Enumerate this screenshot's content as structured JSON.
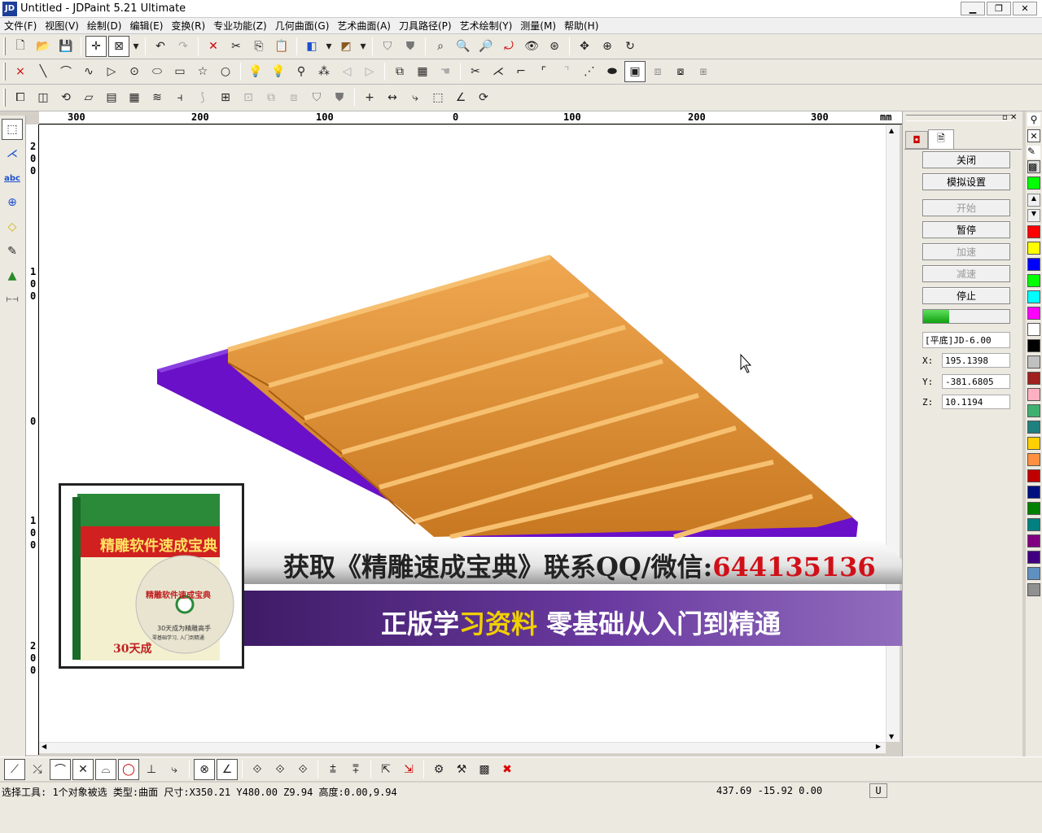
{
  "window": {
    "title": "Untitled - JDPaint 5.21 Ultimate",
    "logo": "JD"
  },
  "menu": [
    "文件(F)",
    "视图(V)",
    "绘制(D)",
    "编辑(E)",
    "变换(R)",
    "专业功能(Z)",
    "几何曲面(G)",
    "艺术曲面(A)",
    "刀具路径(P)",
    "艺术绘制(Y)",
    "测量(M)",
    "帮助(H)"
  ],
  "ruler": {
    "unit": "mm",
    "h_labels": [
      "300",
      "200",
      "100",
      "0",
      "100",
      "200",
      "300"
    ],
    "v_labels": [
      "200",
      "100",
      "0",
      "100",
      "200"
    ]
  },
  "right_panel": {
    "buttons": [
      {
        "label": "关闭",
        "enabled": true
      },
      {
        "label": "模拟设置",
        "enabled": true
      },
      {
        "label": "开始",
        "enabled": false
      },
      {
        "label": "暂停",
        "enabled": true
      },
      {
        "label": "加速",
        "enabled": false
      },
      {
        "label": "减速",
        "enabled": false
      },
      {
        "label": "停止",
        "enabled": true
      }
    ],
    "progress": 0.3,
    "tool": "[平底]JD-6.00",
    "x_label": "X:",
    "x": "195.1398",
    "y_label": "Y:",
    "y": "-381.6805",
    "z_label": "Z:",
    "z": "10.1194"
  },
  "palette": [
    "#00ff00",
    "#ff0000",
    "#ffff00",
    "#0000ff",
    "#00ff00",
    "#00ffff",
    "#ff00ff",
    "#ffffff",
    "#000000",
    "#c0c0c0",
    "#a02020",
    "#ffb0c0",
    "#40b070",
    "#208080",
    "#ffd000",
    "#ff9040",
    "#c00000",
    "#001080",
    "#008000",
    "#008080",
    "#800080",
    "#400080",
    "#6090c0",
    "#909090"
  ],
  "status": {
    "main": "选择工具: 1个对象被选 类型:曲面 尺寸:X350.21 Y480.00 Z9.94 高度:0.00,9.94",
    "coords": "437.69 -15.92 0.00",
    "mode": "U"
  },
  "ad": {
    "line1_a": "获取《精雕速成宝典》联系QQ/微信:",
    "line1_b": "644135136",
    "line2_a": "正版学",
    "line2_b": "习资料",
    "line2_c": "零基础从入门到精通",
    "book_title": "精雕软件速成宝典",
    "disc_title": "精雕软件速成宝典",
    "disc_sub": "30天成为精雕高手",
    "disc_sub2": "零基础学习, 入门到精通",
    "book_bottom": "30天成"
  }
}
